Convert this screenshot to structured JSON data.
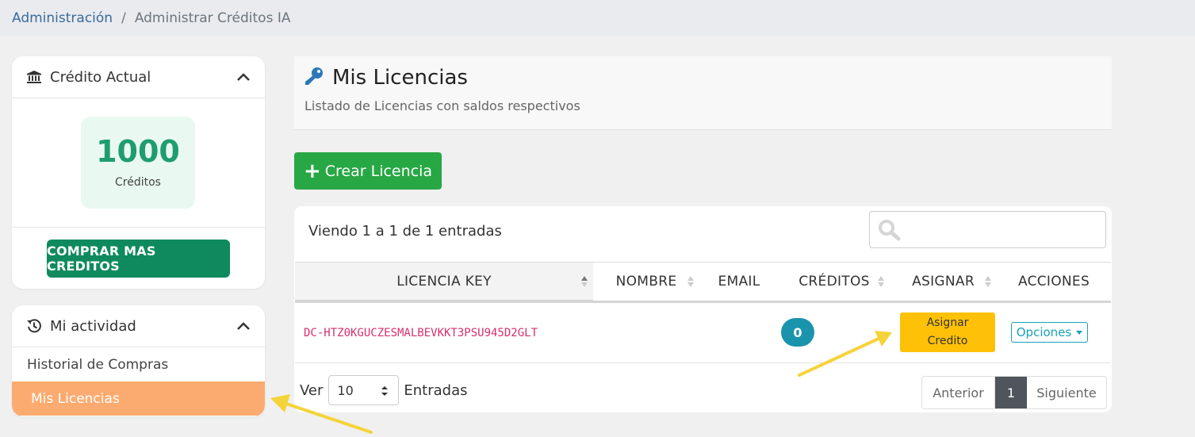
{
  "breadcrumb": {
    "parent": "Administración",
    "separator": "/",
    "current": "Administrar Créditos IA"
  },
  "credit_panel": {
    "title": "Crédito Actual",
    "amount": "1000",
    "unit": "Créditos",
    "buy_label": "COMPRAR MAS CREDITOS",
    "icon": "bank-icon"
  },
  "activity_panel": {
    "title": "Mi actividad",
    "icon": "history-icon",
    "items": [
      {
        "label": "Historial de Compras",
        "active": false
      },
      {
        "label": "Mis Licencias",
        "active": true
      }
    ]
  },
  "page": {
    "title": "Mis Licencias",
    "subtitle": "Listado de Licencias con saldos respectivos",
    "icon": "key-icon",
    "create_label": "Crear Licencia"
  },
  "table": {
    "info": "Viendo 1 a 1 de 1 entradas",
    "search_value": "",
    "columns": [
      "LICENCIA KEY",
      "NOMBRE",
      "EMAIL",
      "CRÉDITOS",
      "ASIGNAR",
      "ACCIONES"
    ],
    "rows": [
      {
        "key": "DC-HTZ0KGUCZESMALBEVKKT3PSU945D2GLT",
        "nombre": "",
        "email": "",
        "creditos": "0",
        "assign_label_line1": "Asignar",
        "assign_label_line2": "Credito",
        "options_label": "Opciones"
      }
    ],
    "length_prefix": "Ver",
    "length_value": "10",
    "length_suffix": "Entradas"
  },
  "pagination": {
    "prev": "Anterior",
    "current": "1",
    "next": "Siguiente"
  },
  "colors": {
    "primary_green": "#28a745",
    "dark_green": "#0f8a5f",
    "active_orange": "#fcab70",
    "assign_yellow": "#ffc107",
    "badge_teal": "#1a94ad",
    "key_pink": "#d6306e",
    "annotation_arrow": "#f5d33a"
  }
}
